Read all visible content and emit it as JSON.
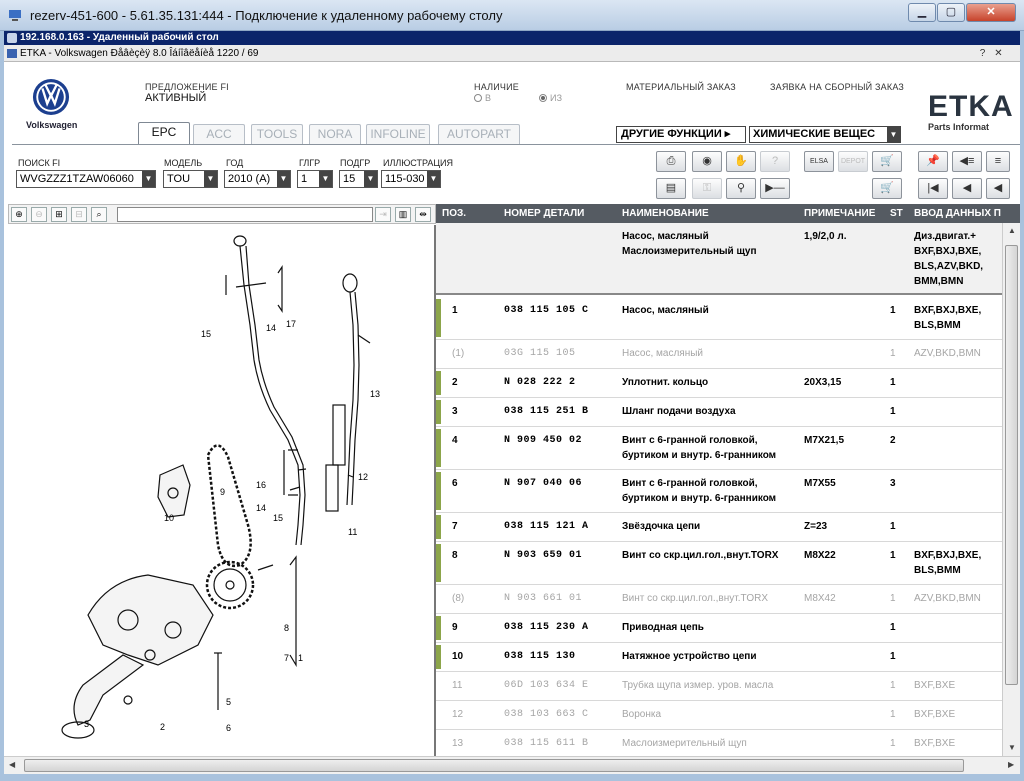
{
  "window": {
    "title": "rezerv-451-600 - 5.61.35.131:444 - Подключение к удаленному рабочему столу"
  },
  "rdp_bar": {
    "title": "192.168.0.163 - Удаленный рабочий стол"
  },
  "app": {
    "title": "ETKA - Volkswagen Ðåâèçèÿ 8.0 Îáíîâëåíèå 1220 / 69"
  },
  "brand": {
    "name": "Volkswagen",
    "etka": "ETKA",
    "etka_sub": "Parts Informat"
  },
  "header": {
    "offer_label": "ПРЕДЛОЖЕНИЕ FI",
    "offer_value": "АКТИВНЫЙ",
    "avail_label": "НАЛИЧИЕ",
    "avail_opt1": "В",
    "avail_opt2": "ИЗ",
    "material_order": "МАТЕРИАЛЬНЫЙ ЗАКАЗ",
    "assembly_order": "ЗАЯВКА НА СБОРНЫЙ ЗАКАЗ"
  },
  "tabs": [
    "EPC",
    "ACC",
    "TOOLS",
    "NORA",
    "INFOLINE",
    "AUTOPART"
  ],
  "other_functions": "ДРУГИЕ ФУНКЦИИ ▸",
  "chemicals_select": "ХИМИЧЕСКИЕ ВЕЩЕС",
  "filters": {
    "search_label": "ПОИСК FI",
    "search_value": "WVGZZZ1TZAW06060",
    "model_label": "МОДЕЛЬ",
    "model_value": "TOU",
    "year_label": "ГОД",
    "year_value": "2010 (A)",
    "mg_label": "ГЛГР",
    "mg_value": "1",
    "sg_label": "ПОДГР",
    "sg_value": "15",
    "ill_label": "ИЛЛЮСТРАЦИЯ",
    "ill_value": "115-030"
  },
  "toolbar_icons": {
    "elsa": "ELSA",
    "depot": "DEPOT"
  },
  "grid": {
    "columns": {
      "pos": "ПОЗ.",
      "part": "НОМЕР ДЕТАЛИ",
      "name": "НАИМЕНОВАНИЕ",
      "note": "ПРИМЕЧАНИЕ",
      "st": "ST",
      "eng": "ВВОД ДАННЫХ П"
    },
    "header_row": {
      "name1": "Насос, масляный",
      "name2": "Маслоизмерительный щуп",
      "note": "1,9/2,0 л.",
      "eng1": "Диз.двигат.+",
      "eng2": "BXF,BXJ,BXE,",
      "eng3": "BLS,AZV,BKD,",
      "eng4": "BMM,BMN"
    },
    "rows": [
      {
        "pos": "1",
        "part": "038 115 105 C",
        "name1": "Насос, масляный",
        "name2": "",
        "note": "",
        "st": "1",
        "eng1": "BXF,BXJ,BXE,",
        "eng2": "BLS,BMM"
      },
      {
        "pos": "(1)",
        "part": "03G 115 105",
        "name1": "Насос, масляный",
        "name2": "",
        "note": "",
        "st": "1",
        "eng1": "AZV,BKD,BMN",
        "eng2": ""
      },
      {
        "pos": "2",
        "part": "N   028 222 2",
        "name1": "Уплотнит. кольцо",
        "name2": "",
        "note": "20X3,15",
        "st": "1",
        "eng1": "",
        "eng2": ""
      },
      {
        "pos": "3",
        "part": "038 115 251 B",
        "name1": "Шланг подачи воздуха",
        "name2": "",
        "note": "",
        "st": "1",
        "eng1": "",
        "eng2": ""
      },
      {
        "pos": "4",
        "part": "N   909 450 02",
        "name1": "Винт с 6-гранной головкой,",
        "name2": "буртиком и внутр. 6-гранником",
        "note": "M7X21,5",
        "st": "2",
        "eng1": "",
        "eng2": ""
      },
      {
        "pos": "6",
        "part": "N   907 040 06",
        "name1": "Винт с 6-гранной головкой,",
        "name2": "буртиком и внутр. 6-гранником",
        "note": "M7X55",
        "st": "3",
        "eng1": "",
        "eng2": ""
      },
      {
        "pos": "7",
        "part": "038 115 121 A",
        "name1": "Звёздочка цепи",
        "name2": "",
        "note": "Z=23",
        "st": "1",
        "eng1": "",
        "eng2": ""
      },
      {
        "pos": "8",
        "part": "N   903 659 01",
        "name1": "Винт со скр.цил.гол.,внут.TORX",
        "name2": "",
        "note": "M8X22",
        "st": "1",
        "eng1": "BXF,BXJ,BXE,",
        "eng2": "BLS,BMM"
      },
      {
        "pos": "(8)",
        "part": "N   903 661 01",
        "name1": "Винт со скр.цил.гол.,внут.TORX",
        "name2": "",
        "note": "M8X42",
        "st": "1",
        "eng1": "AZV,BKD,BMN",
        "eng2": ""
      },
      {
        "pos": "9",
        "part": "038 115 230 A",
        "name1": "Приводная цепь",
        "name2": "",
        "note": "",
        "st": "1",
        "eng1": "",
        "eng2": ""
      },
      {
        "pos": "10",
        "part": "038 115 130",
        "name1": "Натяжное устройство цепи",
        "name2": "",
        "note": "",
        "st": "1",
        "eng1": "",
        "eng2": ""
      },
      {
        "pos": "11",
        "part": "06D 103 634 E",
        "name1": "Трубка щупа измер. уров. масла",
        "name2": "",
        "note": "",
        "st": "1",
        "eng1": "BXF,BXE",
        "eng2": ""
      },
      {
        "pos": "12",
        "part": "038 103 663 C",
        "name1": "Воронка",
        "name2": "",
        "note": "",
        "st": "1",
        "eng1": "BXF,BXE",
        "eng2": ""
      },
      {
        "pos": "13",
        "part": "038 115 611 B",
        "name1": "Маслоизмерительный щуп",
        "name2": "",
        "note": "",
        "st": "1",
        "eng1": "BXF,BXE",
        "eng2": ""
      }
    ]
  },
  "illustration_labels": [
    "1",
    "2",
    "3",
    "4",
    "5",
    "6",
    "7",
    "8",
    "9",
    "10",
    "11",
    "12",
    "13",
    "14",
    "15",
    "15",
    "16",
    "16",
    "17"
  ]
}
